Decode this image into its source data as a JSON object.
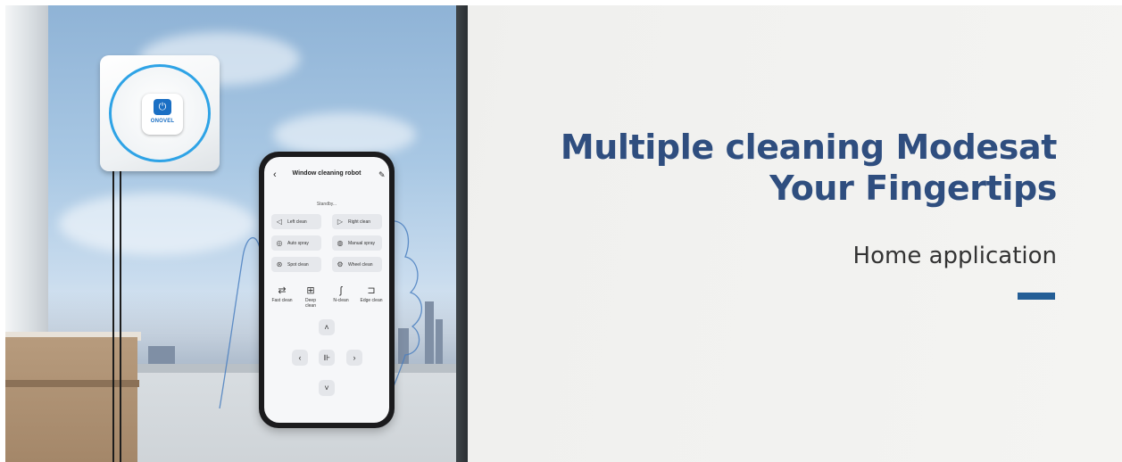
{
  "banner": {
    "headline_line1": "Multiple cleaning Modesat",
    "headline_line2": "Your Fingertips",
    "subtitle": "Home application",
    "accent_color": "#245e96",
    "headline_color": "#2f4e7f"
  },
  "robot": {
    "brand": "ONOVEL",
    "power_icon": "power-icon"
  },
  "app": {
    "title": "Window cleaning robot",
    "back_icon": "back-arrow-icon",
    "edit_icon": "edit-icon",
    "status": "Standby...",
    "modes": [
      {
        "label": "Left clean",
        "icon": "left-clean-icon",
        "glyph": "◁"
      },
      {
        "label": "Right clean",
        "icon": "right-clean-icon",
        "glyph": "▷"
      },
      {
        "label": "Auto spray",
        "icon": "auto-spray-icon",
        "glyph": "◎"
      },
      {
        "label": "Manual spray",
        "icon": "manual-spray-icon",
        "glyph": "◍"
      },
      {
        "label": "Spot clean",
        "icon": "spot-clean-icon",
        "glyph": "⊛"
      },
      {
        "label": "Wheel clean",
        "icon": "wheel-clean-icon",
        "glyph": "⚙"
      }
    ],
    "quick_modes": [
      {
        "label": "Fast clean",
        "icon": "fast-clean-icon",
        "glyph": "⇄"
      },
      {
        "label": "Deep\nclean",
        "icon": "deep-clean-icon",
        "glyph": "⊞"
      },
      {
        "label": "N-clean",
        "icon": "n-clean-icon",
        "glyph": "ʃ"
      },
      {
        "label": "Edge clean",
        "icon": "edge-clean-icon",
        "glyph": "⊐"
      }
    ],
    "dpad": {
      "up": "˄",
      "left": "‹",
      "center": "⊪",
      "right": "›",
      "down": "˅"
    }
  }
}
